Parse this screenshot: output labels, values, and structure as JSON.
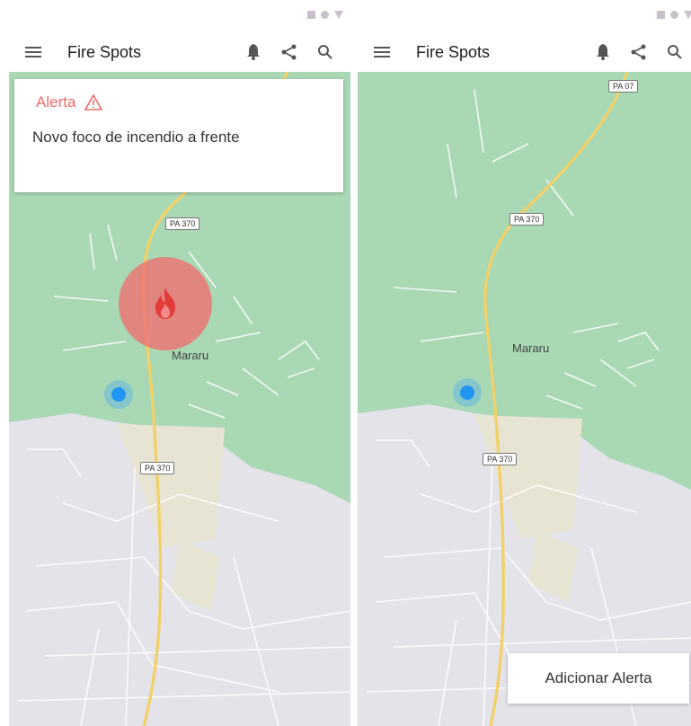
{
  "left_screen": {
    "app_bar": {
      "title": "Fire Spots"
    },
    "alert": {
      "title": "Alerta",
      "message": "Novo foco de incendio a frente"
    },
    "map": {
      "road_labels": [
        "PA 370",
        "PA 370"
      ],
      "place_label": "Mararu"
    }
  },
  "right_screen": {
    "app_bar": {
      "title": "Fire Spots"
    },
    "map": {
      "road_labels": [
        "PA 07",
        "PA 370",
        "PA 370"
      ],
      "place_label": "Mararu"
    },
    "add_alert_label": "Adicionar Alerta"
  },
  "icons": {
    "menu": "menu-icon",
    "notifications": "bell-icon",
    "share": "share-icon",
    "search": "search-icon",
    "alert_warning": "warning-triangle-icon",
    "fire": "fire-icon"
  },
  "colors": {
    "map_green": "#a9d8b5",
    "map_urban": "#e4e3ea",
    "road_yellow": "#f1d16a",
    "alert_red": "#ef6a6a",
    "location_blue": "#2196f3"
  }
}
